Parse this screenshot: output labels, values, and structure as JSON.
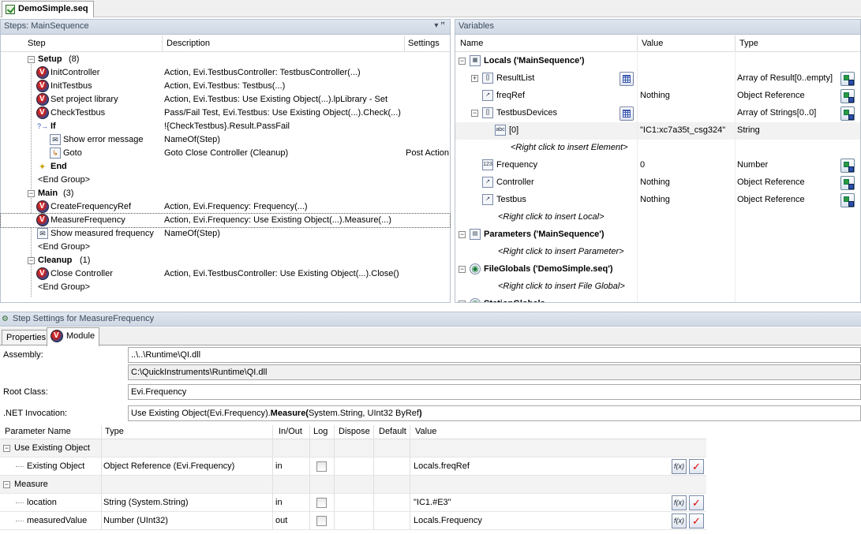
{
  "document_tab": {
    "label": "DemoSimple.seq"
  },
  "steps_pane": {
    "title": "Steps: MainSequence",
    "pin_glyph": "▾ ꟸ",
    "columns": [
      "Step",
      "Description",
      "Settings"
    ],
    "rows": [
      {
        "type": "group",
        "name": "Setup",
        "count": "(8)"
      },
      {
        "type": "step",
        "name": "InitController",
        "desc": "Action,  Evi.TestbusController: TestbusController(...)",
        "settings": ""
      },
      {
        "type": "step",
        "name": "InitTestbus",
        "desc": "Action,  Evi.Testbus: Testbus(...)",
        "settings": ""
      },
      {
        "type": "step",
        "name": "Set project library",
        "desc": "Action,  Evi.Testbus: Use Existing Object(...).lpLibrary - Set",
        "settings": ""
      },
      {
        "type": "step",
        "name": "CheckTestbus",
        "desc": "Pass/Fail Test,  Evi.Testbus: Use Existing Object(...).Check(...)",
        "settings": ""
      },
      {
        "type": "if",
        "name": "If",
        "desc": "!{CheckTestbus}.Result.PassFail",
        "settings": ""
      },
      {
        "type": "msg",
        "name": "Show error message",
        "desc": "NameOf(Step)",
        "settings": ""
      },
      {
        "type": "goto",
        "name": "Goto",
        "desc": "Goto Close Controller (Cleanup)",
        "settings": "Post Action"
      },
      {
        "type": "end",
        "name": "End",
        "desc": "",
        "settings": ""
      },
      {
        "type": "endgroup",
        "name": "<End Group>"
      },
      {
        "type": "group",
        "name": "Main",
        "count": "(3)"
      },
      {
        "type": "step",
        "name": "CreateFrequencyRef",
        "desc": "Action,  Evi.Frequency: Frequency(...)",
        "settings": ""
      },
      {
        "type": "step",
        "name": "MeasureFrequency",
        "desc": "Action,  Evi.Frequency: Use Existing Object(...).Measure(...)",
        "settings": "",
        "selected": true
      },
      {
        "type": "msg",
        "name": "Show measured frequency",
        "desc": "NameOf(Step)",
        "settings": ""
      },
      {
        "type": "endgroup",
        "name": "<End Group>"
      },
      {
        "type": "group",
        "name": "Cleanup",
        "count": "(1)"
      },
      {
        "type": "step",
        "name": "Close Controller",
        "desc": "Action,  Evi.TestbusController: Use Existing Object(...).Close()",
        "settings": ""
      },
      {
        "type": "endgroup",
        "name": "<End Group>"
      }
    ]
  },
  "variables_pane": {
    "title": "Variables",
    "columns": [
      "Name",
      "Value",
      "Type"
    ],
    "rows": [
      {
        "name": "Locals ('MainSequence')",
        "value": "",
        "type": "",
        "bold": true
      },
      {
        "name": "ResultList",
        "value": "",
        "type": "Array of Result[0..empty]"
      },
      {
        "name": "freqRef",
        "value": "Nothing",
        "type": "Object Reference"
      },
      {
        "name": "TestbusDevices",
        "value": "",
        "type": "Array of Strings[0..0]"
      },
      {
        "name": "[0]",
        "value": "\"IC1:xc7a35t_csg324\"",
        "type": "String"
      },
      {
        "name": "<Right click to insert Element>",
        "value": "",
        "type": "",
        "italic": true
      },
      {
        "name": "Frequency",
        "value": "0",
        "type": "Number"
      },
      {
        "name": "Controller",
        "value": "Nothing",
        "type": "Object Reference"
      },
      {
        "name": "Testbus",
        "value": "Nothing",
        "type": "Object Reference"
      },
      {
        "name": "<Right click to insert Local>",
        "value": "",
        "type": "",
        "italic": true
      },
      {
        "name": "Parameters ('MainSequence')",
        "value": "",
        "type": "",
        "bold": true
      },
      {
        "name": "<Right click to insert Parameter>",
        "value": "",
        "type": "",
        "italic": true
      },
      {
        "name": "FileGlobals ('DemoSimple.seq')",
        "value": "",
        "type": "",
        "bold": true
      },
      {
        "name": "<Right click to insert File Global>",
        "value": "",
        "type": "",
        "italic": true
      },
      {
        "name": "StationGlobals",
        "value": "",
        "type": "",
        "bold": true
      }
    ]
  },
  "step_settings": {
    "title": "Step Settings for MeasureFrequency",
    "tabs": [
      "Properties",
      "Module"
    ],
    "assembly_label": "Assembly:",
    "assembly_value": "..\\..\\Runtime\\QI.dll",
    "assembly_resolved": "C:\\QuickInstruments\\Runtime\\QI.dll",
    "root_class_label": "Root Class:",
    "root_class_value": "Evi.Frequency",
    "invocation_label": ".NET Invocation:",
    "invocation_prefix": "Use Existing Object(Evi.Frequency).",
    "invocation_method": "Measure(",
    "invocation_args": "System.String, UInt32 ByRef",
    "invocation_close": ")",
    "param_columns": [
      "Parameter Name",
      "Type",
      "In/Out",
      "Log",
      "Dispose",
      "Default",
      "Value"
    ],
    "param_rows": [
      {
        "group": true,
        "name": "Use Existing Object"
      },
      {
        "name": "Existing Object",
        "type": "Object Reference (Evi.Frequency)",
        "inout": "in",
        "value": "Locals.freqRef"
      },
      {
        "group": true,
        "name": "Measure"
      },
      {
        "name": "location",
        "type": "String (System.String)",
        "inout": "in",
        "value": "\"IC1.#E3\""
      },
      {
        "name": "measuredValue",
        "type": "Number (UInt32)",
        "inout": "out",
        "value": "Locals.Frequency"
      }
    ],
    "fx_label": "f(x)",
    "check_glyph": "✓"
  }
}
